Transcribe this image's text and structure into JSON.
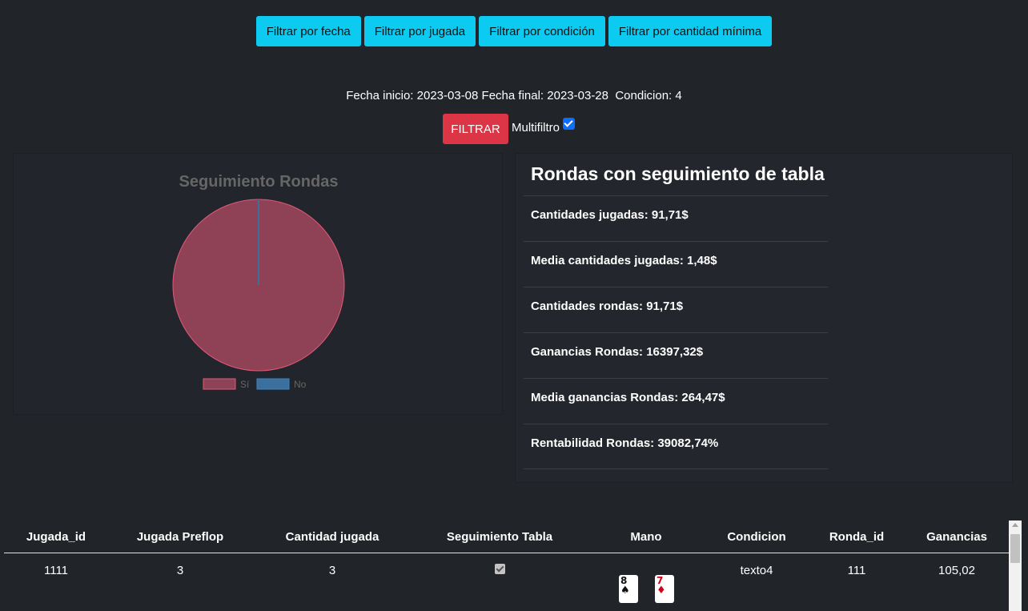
{
  "filters": {
    "by_date": "Filtrar por fecha",
    "by_play": "Filtrar por jugada",
    "by_condition": "Filtrar por condición",
    "by_min_amount": "Filtrar por cantidad mínima"
  },
  "criteria": {
    "start_label": "Fecha inicio:",
    "start_date": "2023-03-08",
    "end_label": "Fecha final:",
    "end_date": "2023-03-28",
    "condition_label": "Condicion:",
    "condition_value": "4"
  },
  "filter_button": "FILTRAR",
  "multifilter_label": "Multifiltro",
  "multifilter_checked": true,
  "chart_data": {
    "type": "pie",
    "title": "Seguimiento Rondas",
    "categories": [
      "Sí",
      "No"
    ],
    "values": [
      100,
      0
    ],
    "colors": [
      "#8f4255",
      "#3b6f9e"
    ],
    "legend": "bottom"
  },
  "stats": {
    "title": "Rondas con seguimiento de tabla",
    "items": [
      "Cantidades jugadas: 91,71$",
      "Media cantidades jugadas: 1,48$",
      "Cantidades rondas: 91,71$",
      "Ganancias Rondas: 16397,32$",
      "Media ganancias Rondas: 264,47$",
      "Rentabilidad Rondas: 39082,74%"
    ]
  },
  "table": {
    "headers": {
      "jugada_id": "Jugada_id",
      "preflop": "Jugada Preflop",
      "cantidad": "Cantidad jugada",
      "seguimiento": "Seguimiento Tabla",
      "mano": "Mano",
      "condicion": "Condicion",
      "ronda_id": "Ronda_id",
      "ganancias": "Ganancias"
    },
    "rows": [
      {
        "jugada_id": "1111",
        "preflop": "3",
        "cantidad": "3",
        "seguimiento": true,
        "cards": [
          {
            "rank": "8",
            "suit": "♠"
          },
          {
            "rank": "7",
            "suit": "♦"
          }
        ],
        "condicion": "texto4",
        "ronda_id": "111",
        "ganancias": "105,02"
      }
    ]
  }
}
